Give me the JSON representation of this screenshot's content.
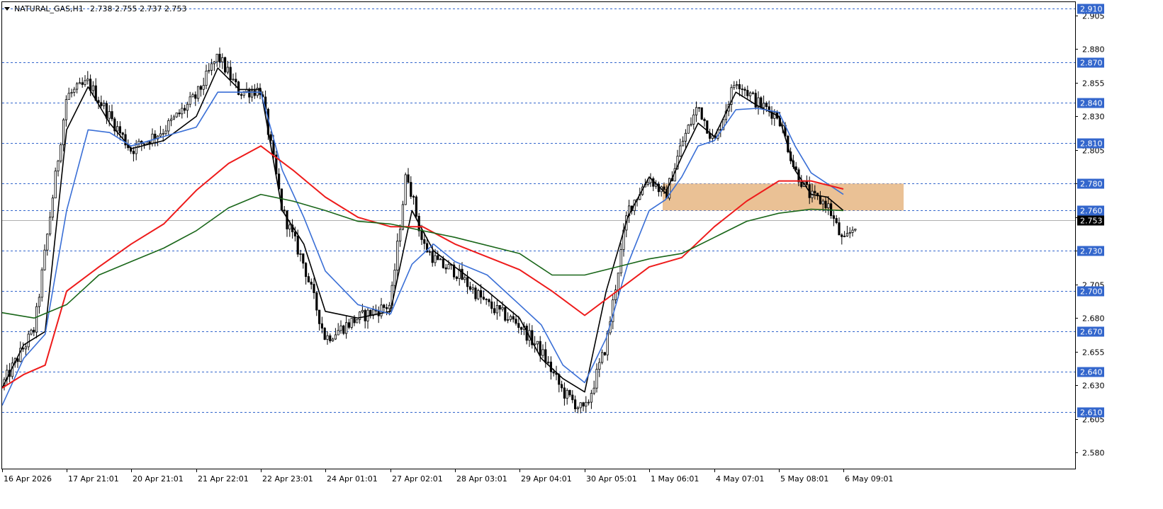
{
  "header": {
    "symbol": "NATURAL_GAS,H1",
    "ohlc": "2.738 2.755 2.737 2.753"
  },
  "colors": {
    "background": "#ffffff",
    "candle": "#000000",
    "level_line": "#3366cc",
    "label_bg": "#3366cc",
    "label_text": "#ffffff",
    "current_price_bg": "#000000",
    "ma_black": "#000000",
    "ma_blue": "#3a6fd6",
    "ma_red": "#ee1b1b",
    "ma_green": "#196619",
    "zone": "#e6b683"
  },
  "chart_data": {
    "type": "candlestick",
    "symbol": "NATURAL_GAS",
    "timeframe": "H1",
    "ylim": [
      2.568,
      2.915
    ],
    "y_ticks": [
      "2.905",
      "2.880",
      "2.855",
      "2.830",
      "2.805",
      "2.780",
      "2.755",
      "2.730",
      "2.705",
      "2.680",
      "2.655",
      "2.630",
      "2.605",
      "2.580"
    ],
    "x_labels": [
      "16 Apr 2026",
      "17 Apr 21:01",
      "20 Apr 21:01",
      "21 Apr 22:01",
      "22 Apr 23:01",
      "24 Apr 01:01",
      "27 Apr 02:01",
      "28 Apr 03:01",
      "29 Apr 04:01",
      "30 Apr 05:01",
      "1 May 06:01",
      "4 May 07:01",
      "5 May 08:01",
      "6 May 09:01"
    ],
    "levels": [
      "2.910",
      "2.870",
      "2.840",
      "2.810",
      "2.780",
      "2.760",
      "2.730",
      "2.700",
      "2.670",
      "2.640",
      "2.610"
    ],
    "current_price": "2.753",
    "zone": {
      "from": 2.76,
      "to": 2.78,
      "start_label": "1 May 06:01"
    },
    "anchors": [
      {
        "x": "16 Apr 2026",
        "price": 2.63
      },
      {
        "x": "",
        "price": 2.672
      },
      {
        "x": "17 Apr 21:01",
        "price": 2.845
      },
      {
        "x": "",
        "price": 2.855
      },
      {
        "x": "",
        "price": 2.83
      },
      {
        "x": "20 Apr 21:01",
        "price": 2.805
      },
      {
        "x": "",
        "price": 2.82
      },
      {
        "x": "21 Apr 22:01",
        "price": 2.845
      },
      {
        "x": "",
        "price": 2.875
      },
      {
        "x": "",
        "price": 2.848
      },
      {
        "x": "22 Apr 23:01",
        "price": 2.85
      },
      {
        "x": "",
        "price": 2.76
      },
      {
        "x": "",
        "price": 2.72
      },
      {
        "x": "24 Apr 01:01",
        "price": 2.665
      },
      {
        "x": "",
        "price": 2.68
      },
      {
        "x": "27 Apr 02:01",
        "price": 2.69
      },
      {
        "x": "",
        "price": 2.79
      },
      {
        "x": "",
        "price": 2.735
      },
      {
        "x": "",
        "price": 2.72
      },
      {
        "x": "28 Apr 03:01",
        "price": 2.715
      },
      {
        "x": "",
        "price": 2.69
      },
      {
        "x": "29 Apr 04:01",
        "price": 2.675
      },
      {
        "x": "",
        "price": 2.655
      },
      {
        "x": "",
        "price": 2.625
      },
      {
        "x": "30 Apr 05:01",
        "price": 2.61
      },
      {
        "x": "",
        "price": 2.66
      },
      {
        "x": "",
        "price": 2.76
      },
      {
        "x": "1 May 06:01",
        "price": 2.785
      },
      {
        "x": "",
        "price": 2.77
      },
      {
        "x": "",
        "price": 2.81
      },
      {
        "x": "",
        "price": 2.838
      },
      {
        "x": "4 May 07:01",
        "price": 2.81
      },
      {
        "x": "",
        "price": 2.858
      },
      {
        "x": "",
        "price": 2.84
      },
      {
        "x": "5 May 08:01",
        "price": 2.83
      },
      {
        "x": "",
        "price": 2.79
      },
      {
        "x": "",
        "price": 2.77
      },
      {
        "x": "",
        "price": 2.765
      },
      {
        "x": "6 May 09:01",
        "price": 2.735
      },
      {
        "x": "",
        "price": 2.753
      }
    ],
    "moving_averages": [
      {
        "color": "#000000",
        "points": [
          {
            "x": "16 Apr 2026",
            "price": 2.628
          },
          {
            "x": "",
            "price": 2.66
          },
          {
            "x": "",
            "price": 2.67
          },
          {
            "x": "17 Apr 21:01",
            "price": 2.82
          },
          {
            "x": "",
            "price": 2.852
          },
          {
            "x": "",
            "price": 2.825
          },
          {
            "x": "20 Apr 21:01",
            "price": 2.806
          },
          {
            "x": "",
            "price": 2.812
          },
          {
            "x": "21 Apr 22:01",
            "price": 2.83
          },
          {
            "x": "",
            "price": 2.866
          },
          {
            "x": "",
            "price": 2.85
          },
          {
            "x": "22 Apr 23:01",
            "price": 2.85
          },
          {
            "x": "",
            "price": 2.76
          },
          {
            "x": "",
            "price": 2.735
          },
          {
            "x": "24 Apr 01:01",
            "price": 2.685
          },
          {
            "x": "",
            "price": 2.68
          },
          {
            "x": "27 Apr 02:01",
            "price": 2.685
          },
          {
            "x": "",
            "price": 2.76
          },
          {
            "x": "",
            "price": 2.73
          },
          {
            "x": "28 Apr 03:01",
            "price": 2.718
          },
          {
            "x": "",
            "price": 2.7
          },
          {
            "x": "29 Apr 04:01",
            "price": 2.68
          },
          {
            "x": "",
            "price": 2.65
          },
          {
            "x": "",
            "price": 2.635
          },
          {
            "x": "30 Apr 05:01",
            "price": 2.625
          },
          {
            "x": "",
            "price": 2.7
          },
          {
            "x": "",
            "price": 2.755
          },
          {
            "x": "1 May 06:01",
            "price": 2.785
          },
          {
            "x": "",
            "price": 2.773
          },
          {
            "x": "",
            "price": 2.8
          },
          {
            "x": "",
            "price": 2.825
          },
          {
            "x": "4 May 07:01",
            "price": 2.815
          },
          {
            "x": "",
            "price": 2.848
          },
          {
            "x": "",
            "price": 2.838
          },
          {
            "x": "5 May 08:01",
            "price": 2.83
          },
          {
            "x": "",
            "price": 2.79
          },
          {
            "x": "",
            "price": 2.772
          },
          {
            "x": "",
            "price": 2.77
          },
          {
            "x": "6 May 09:01",
            "price": 2.76
          }
        ]
      },
      {
        "color": "#3a6fd6",
        "points": [
          {
            "x": "16 Apr 2026",
            "price": 2.615
          },
          {
            "x": "",
            "price": 2.65
          },
          {
            "x": "",
            "price": 2.668
          },
          {
            "x": "17 Apr 21:01",
            "price": 2.76
          },
          {
            "x": "",
            "price": 2.82
          },
          {
            "x": "",
            "price": 2.818
          },
          {
            "x": "20 Apr 21:01",
            "price": 2.808
          },
          {
            "x": "",
            "price": 2.815
          },
          {
            "x": "21 Apr 22:01",
            "price": 2.822
          },
          {
            "x": "",
            "price": 2.848
          },
          {
            "x": "",
            "price": 2.848
          },
          {
            "x": "22 Apr 23:01",
            "price": 2.848
          },
          {
            "x": "",
            "price": 2.79
          },
          {
            "x": "",
            "price": 2.755
          },
          {
            "x": "24 Apr 01:01",
            "price": 2.715
          },
          {
            "x": "",
            "price": 2.69
          },
          {
            "x": "27 Apr 02:01",
            "price": 2.683
          },
          {
            "x": "",
            "price": 2.72
          },
          {
            "x": "",
            "price": 2.735
          },
          {
            "x": "28 Apr 03:01",
            "price": 2.722
          },
          {
            "x": "",
            "price": 2.712
          },
          {
            "x": "29 Apr 04:01",
            "price": 2.69
          },
          {
            "x": "",
            "price": 2.675
          },
          {
            "x": "",
            "price": 2.645
          },
          {
            "x": "30 Apr 05:01",
            "price": 2.632
          },
          {
            "x": "",
            "price": 2.665
          },
          {
            "x": "",
            "price": 2.72
          },
          {
            "x": "1 May 06:01",
            "price": 2.76
          },
          {
            "x": "",
            "price": 2.768
          },
          {
            "x": "",
            "price": 2.785
          },
          {
            "x": "",
            "price": 2.808
          },
          {
            "x": "4 May 07:01",
            "price": 2.812
          },
          {
            "x": "",
            "price": 2.835
          },
          {
            "x": "",
            "price": 2.836
          },
          {
            "x": "5 May 08:01",
            "price": 2.833
          },
          {
            "x": "",
            "price": 2.808
          },
          {
            "x": "",
            "price": 2.788
          },
          {
            "x": "",
            "price": 2.78
          },
          {
            "x": "6 May 09:01",
            "price": 2.772
          }
        ]
      },
      {
        "color": "#ee1b1b",
        "points": [
          {
            "x": "16 Apr 2026",
            "price": 2.628
          },
          {
            "x": "",
            "price": 2.638
          },
          {
            "x": "",
            "price": 2.645
          },
          {
            "x": "17 Apr 21:01",
            "price": 2.7
          },
          {
            "x": "",
            "price": 2.718
          },
          {
            "x": "20 Apr 21:01",
            "price": 2.735
          },
          {
            "x": "",
            "price": 2.75
          },
          {
            "x": "21 Apr 22:01",
            "price": 2.775
          },
          {
            "x": "",
            "price": 2.795
          },
          {
            "x": "22 Apr 23:01",
            "price": 2.808
          },
          {
            "x": "",
            "price": 2.79
          },
          {
            "x": "24 Apr 01:01",
            "price": 2.77
          },
          {
            "x": "",
            "price": 2.755
          },
          {
            "x": "27 Apr 02:01",
            "price": 2.748
          },
          {
            "x": "",
            "price": 2.748
          },
          {
            "x": "28 Apr 03:01",
            "price": 2.735
          },
          {
            "x": "29 Apr 04:01",
            "price": 2.716
          },
          {
            "x": "",
            "price": 2.7
          },
          {
            "x": "30 Apr 05:01",
            "price": 2.682
          },
          {
            "x": "",
            "price": 2.7
          },
          {
            "x": "1 May 06:01",
            "price": 2.718
          },
          {
            "x": "",
            "price": 2.725
          },
          {
            "x": "4 May 07:01",
            "price": 2.748
          },
          {
            "x": "",
            "price": 2.767
          },
          {
            "x": "5 May 08:01",
            "price": 2.782
          },
          {
            "x": "",
            "price": 2.782
          },
          {
            "x": "6 May 09:01",
            "price": 2.776
          }
        ]
      },
      {
        "color": "#196619",
        "points": [
          {
            "x": "16 Apr 2026",
            "price": 2.684
          },
          {
            "x": "",
            "price": 2.68
          },
          {
            "x": "17 Apr 21:01",
            "price": 2.69
          },
          {
            "x": "",
            "price": 2.712
          },
          {
            "x": "20 Apr 21:01",
            "price": 2.722
          },
          {
            "x": "",
            "price": 2.732
          },
          {
            "x": "21 Apr 22:01",
            "price": 2.745
          },
          {
            "x": "",
            "price": 2.762
          },
          {
            "x": "22 Apr 23:01",
            "price": 2.772
          },
          {
            "x": "",
            "price": 2.767
          },
          {
            "x": "24 Apr 01:01",
            "price": 2.76
          },
          {
            "x": "",
            "price": 2.752
          },
          {
            "x": "27 Apr 02:01",
            "price": 2.75
          },
          {
            "x": "",
            "price": 2.745
          },
          {
            "x": "28 Apr 03:01",
            "price": 2.74
          },
          {
            "x": "29 Apr 04:01",
            "price": 2.728
          },
          {
            "x": "",
            "price": 2.712
          },
          {
            "x": "30 Apr 05:01",
            "price": 2.712
          },
          {
            "x": "",
            "price": 2.718
          },
          {
            "x": "1 May 06:01",
            "price": 2.724
          },
          {
            "x": "",
            "price": 2.728
          },
          {
            "x": "4 May 07:01",
            "price": 2.74
          },
          {
            "x": "",
            "price": 2.752
          },
          {
            "x": "5 May 08:01",
            "price": 2.758
          },
          {
            "x": "",
            "price": 2.761
          },
          {
            "x": "6 May 09:01",
            "price": 2.76
          }
        ]
      }
    ]
  }
}
